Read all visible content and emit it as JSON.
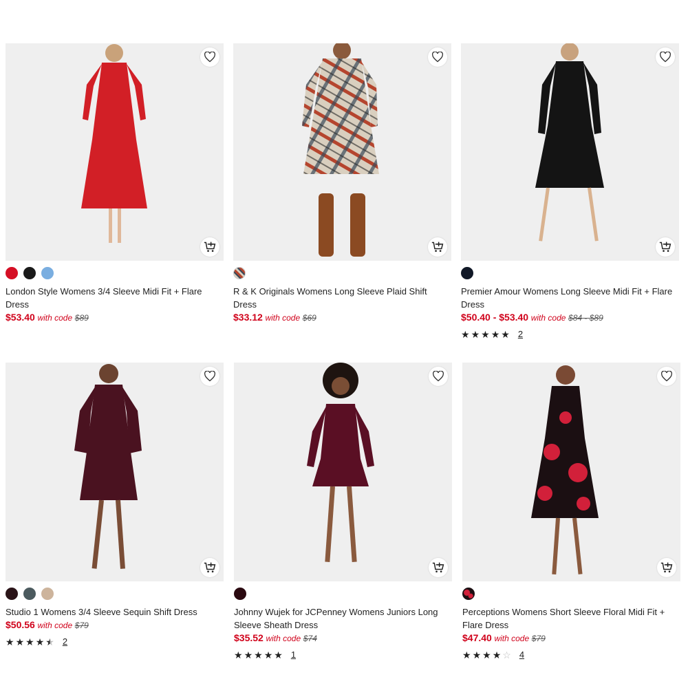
{
  "products": [
    {
      "title": "London Style Womens 3/4 Sleeve Midi Fit + Flare Dress",
      "price": "$53.40",
      "with_code": "with code",
      "original": "$89",
      "swatches": [
        "#d50f25",
        "#1a1a1a",
        "#7aaee0"
      ],
      "rating": null,
      "reviews": null,
      "dress_color": "#d21f26"
    },
    {
      "title": "R & K Originals Womens Long Sleeve Plaid Shift Dress",
      "price": "$33.12",
      "with_code": "with code",
      "original": "$69",
      "swatches": [
        "plaid"
      ],
      "rating": null,
      "reviews": null,
      "dress_color": "#b5452e"
    },
    {
      "title": "Premier Amour Womens Long Sleeve Midi Fit + Flare Dress",
      "price": "$50.40 - $53.40",
      "with_code": "with code",
      "original": "$84 - $89",
      "swatches": [
        "#111827"
      ],
      "rating": 5,
      "reviews": "2",
      "dress_color": "#111"
    },
    {
      "title": "Studio 1 Womens 3/4 Sleeve Sequin Shift Dress",
      "price": "$50.56",
      "with_code": "with code",
      "original": "$79",
      "swatches": [
        "#2a1418",
        "#4b5a5e",
        "#cdb49c"
      ],
      "rating": 4.5,
      "reviews": "2",
      "dress_color": "#4a1220"
    },
    {
      "title": "Johnny Wujek for JCPenney Womens Juniors Long Sleeve Sheath Dress",
      "price": "$35.52",
      "with_code": "with code",
      "original": "$74",
      "swatches": [
        "#2a0910"
      ],
      "rating": 5,
      "reviews": "1",
      "dress_color": "#5a0f24"
    },
    {
      "title": "Perceptions Womens Short Sleeve Floral Midi Fit + Flare Dress",
      "price": "$47.40",
      "with_code": "with code",
      "original": "$79",
      "swatches": [
        "floral"
      ],
      "rating": 4,
      "reviews": "4",
      "dress_color": "#1b0f12"
    }
  ]
}
